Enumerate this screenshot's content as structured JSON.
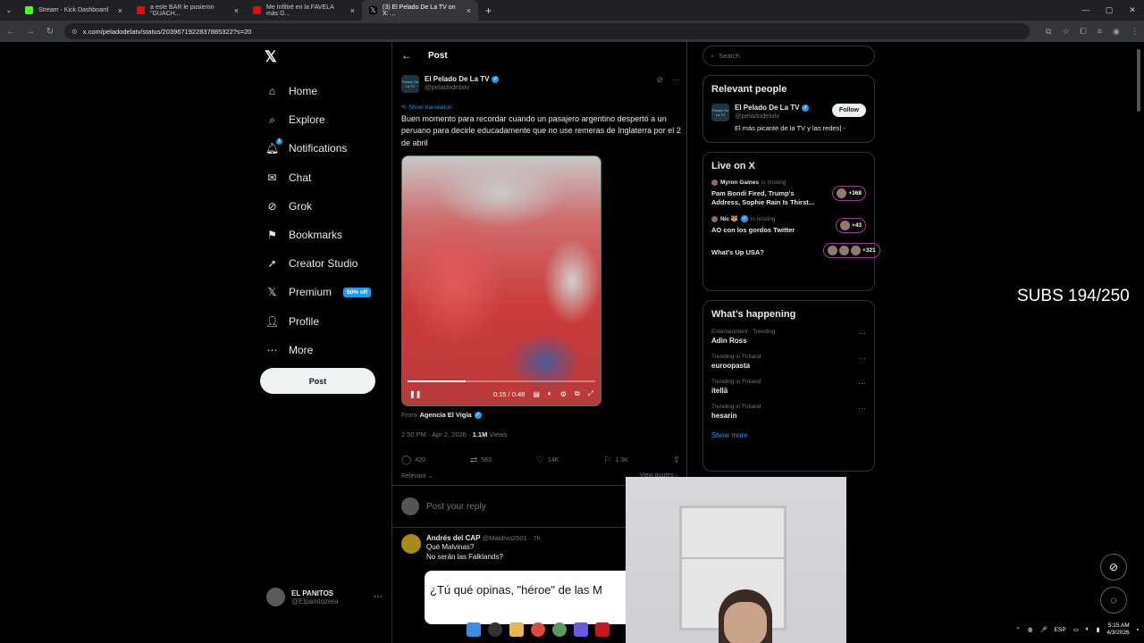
{
  "browser": {
    "tabs": [
      {
        "label": "Stream - Kick Dashboard",
        "color": "#53fc18"
      },
      {
        "label": "a este BAR le pusieron \"GUACH...",
        "color": "#ff0000"
      },
      {
        "label": "Me Infiltré en la FAVELA más G...",
        "color": "#ff0000"
      },
      {
        "label": "(3) El Pelado De La TV on X: ...",
        "color": "#ffffff"
      }
    ],
    "url_host": "x.com/peladodelatv/status/2039671922837885322?s=20"
  },
  "sidebar": {
    "logo": "𝕏",
    "items": [
      {
        "label": "Home",
        "icon": "⌂"
      },
      {
        "label": "Explore",
        "icon": "⌕"
      },
      {
        "label": "Notifications",
        "icon": "🔔︎"
      },
      {
        "label": "Chat",
        "icon": "✉"
      },
      {
        "label": "Grok",
        "icon": "⊘"
      },
      {
        "label": "Bookmarks",
        "icon": "⚑"
      },
      {
        "label": "Creator Studio",
        "icon": "➚"
      },
      {
        "label": "Premium",
        "icon": "𝕏"
      },
      {
        "label": "Profile",
        "icon": "👤︎"
      },
      {
        "label": "More",
        "icon": "⋯"
      }
    ],
    "notif_badge": "1",
    "premium_promo": "50% off",
    "post_button": "Post",
    "account": {
      "name": "EL PANITOS",
      "handle": "@Elpanitozera"
    }
  },
  "post": {
    "header_title": "Post",
    "author_name": "El Pelado De La TV",
    "author_handle": "@peladodelatv",
    "avatar_text": "Pelado De La TV",
    "show_translation": "Show translation",
    "text": "Buen momento para recordar cuando un pasajero argentino despertó a un peruano para decirle educadamente que no use remeras de Inglaterra por el 2 de abril",
    "video": {
      "time": "0:15 / 0:48",
      "progress": 0.31
    },
    "from_label": "From",
    "from_source": "Agencia El Vigía",
    "timestamp": "2:50 PM · Apr 2, 2026 ·",
    "views_count": "1.1M",
    "views_label": "Views",
    "stats": {
      "replies": "420",
      "reposts": "583",
      "likes": "14K",
      "bookmarks": "1.3K"
    },
    "sort_label": "Relevant",
    "view_quotes": "View quotes",
    "reply_placeholder": "Post your reply"
  },
  "reply": {
    "name": "Andrés del CAP",
    "handle": "@Maldivo2501 · 7h",
    "line1": "Qué Malvinas?",
    "line2": "No serán las Falklands?",
    "image_text": "¿Tú qué opinas, \"héroe\" de las M"
  },
  "right": {
    "search_placeholder": "Search",
    "relevant_title": "Relevant people",
    "person": {
      "name": "El Pelado De La TV",
      "handle": "@peladodelatv",
      "bio": "El más picante de la TV y las redes| -",
      "follow": "Follow"
    },
    "live_title": "Live on X",
    "live": [
      {
        "host": "Myron Gaines",
        "hosting": "is hosting",
        "title": "Pam Bondi Fired, Trump's Address, Sophie Rain Is Thirst...",
        "count": "+368"
      },
      {
        "host": "Nic 🐯",
        "hosting": "is hosting",
        "title": "AO con los gordos Twitter",
        "count": "+43"
      },
      {
        "host": "",
        "hosting": "",
        "title": "What's Up USA?",
        "count": "+321"
      }
    ],
    "happening_title": "What’s happening",
    "trends": [
      {
        "cat": "Entertainment · Trending",
        "title": "Adin Ross"
      },
      {
        "cat": "Trending in Finland",
        "title": "euroopasta"
      },
      {
        "cat": "Trending in Finland",
        "title": "itellä"
      },
      {
        "cat": "Trending in Finland",
        "title": "hesarin"
      }
    ],
    "show_more": "Show more"
  },
  "overlay": {
    "subs": "SUBS 194/250"
  },
  "tray": {
    "lang": "ESP",
    "time": "5:15 AM",
    "date": "4/3/2026"
  }
}
